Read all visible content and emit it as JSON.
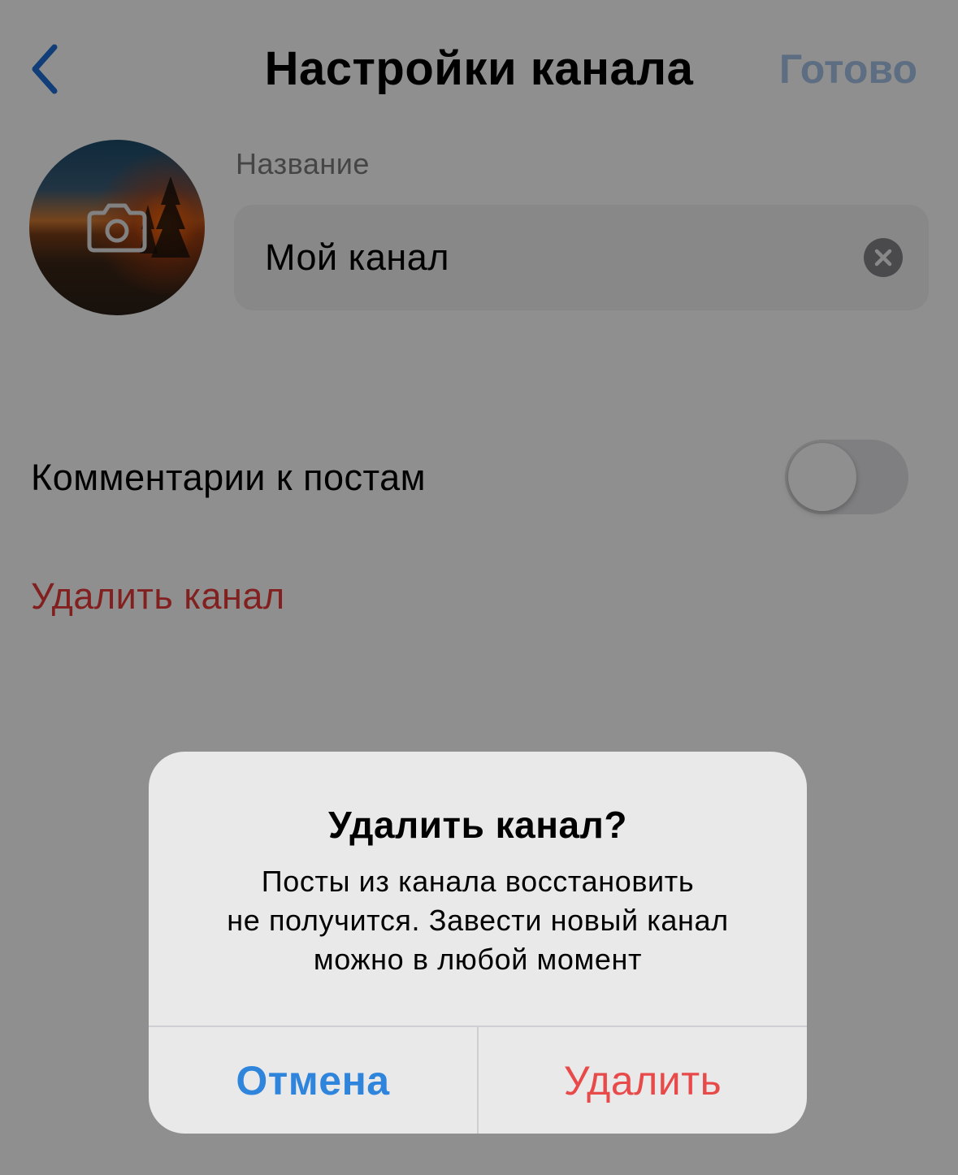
{
  "nav": {
    "title": "Настройки канала",
    "done_label": "Готово"
  },
  "avatar": {
    "camera_icon": "camera-icon"
  },
  "name": {
    "label": "Название",
    "value": "Мой канал"
  },
  "comments": {
    "label": "Комментарии к постам",
    "enabled": false
  },
  "delete_channel_label": "Удалить канал",
  "alert": {
    "title": "Удалить канал?",
    "message_lines": [
      "Посты из канала восстановить",
      "не получится. Завести новый канал",
      "можно в любой момент"
    ],
    "cancel_label": "Отмена",
    "delete_label": "Удалить"
  },
  "colors": {
    "accent_blue": "#2f84dc",
    "destructive_red": "#e83a3a"
  }
}
